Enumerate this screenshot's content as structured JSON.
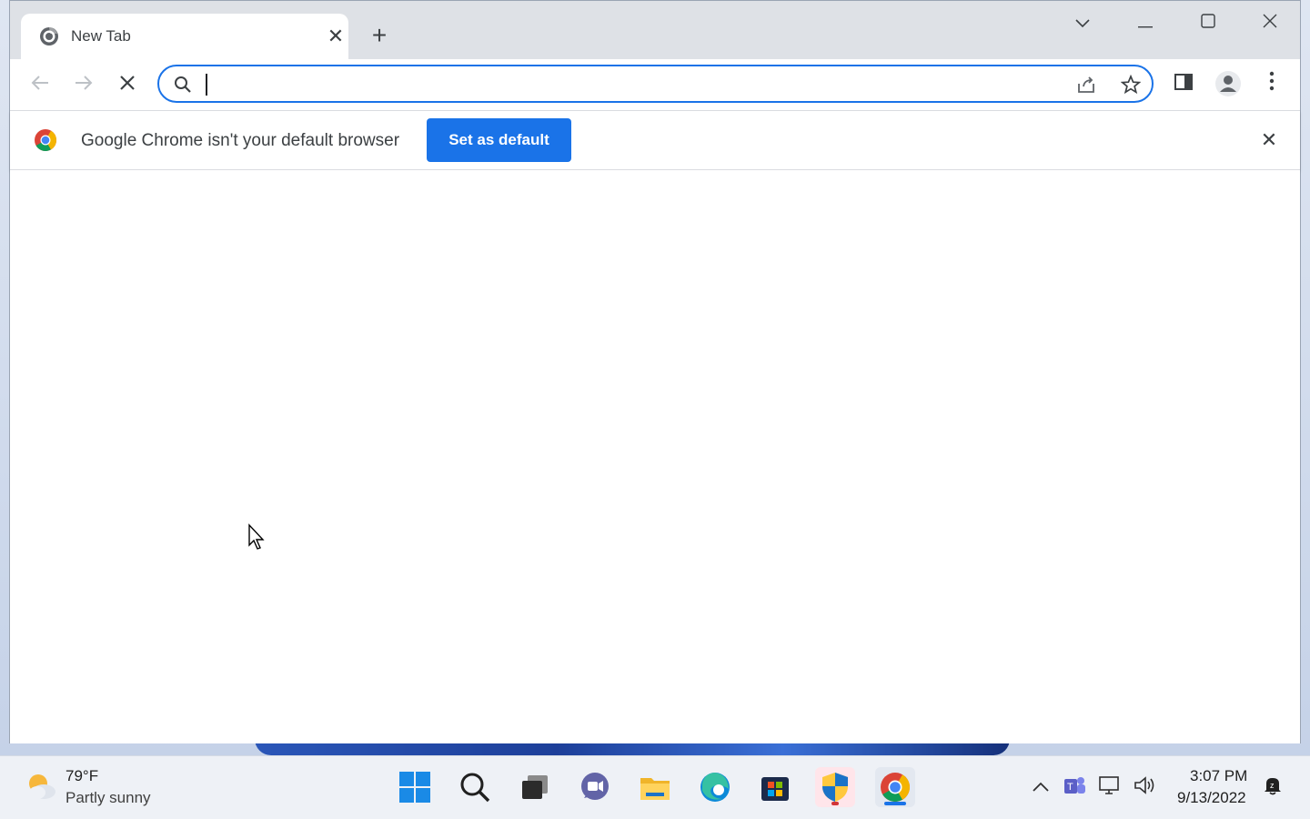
{
  "browser": {
    "tab": {
      "title": "New Tab"
    },
    "omnibox": {
      "value": "",
      "placeholder": ""
    },
    "infobar": {
      "message": "Google Chrome isn't your default browser",
      "button_label": "Set as default"
    }
  },
  "taskbar": {
    "weather": {
      "temp": "79°F",
      "desc": "Partly sunny"
    },
    "clock": {
      "time": "3:07 PM",
      "date": "9/13/2022"
    }
  },
  "colors": {
    "accent": "#1a73e8",
    "tabstrip": "#dee1e6"
  }
}
